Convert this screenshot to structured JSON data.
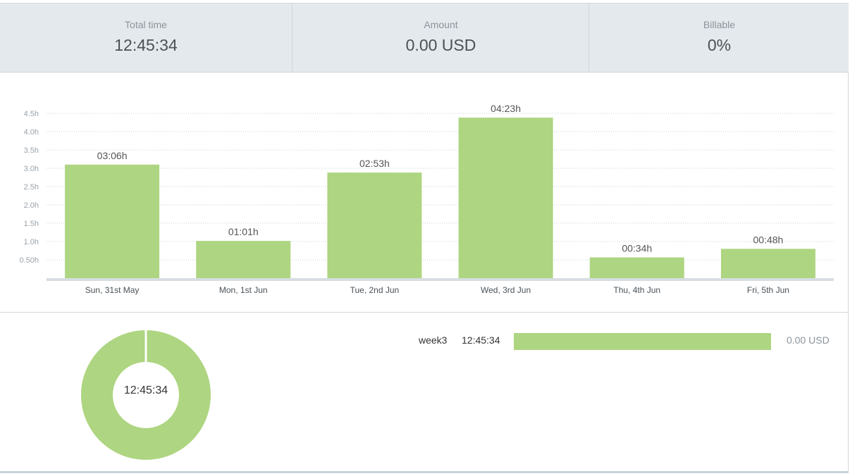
{
  "summary": {
    "total_time": {
      "label": "Total time",
      "value": "12:45:34"
    },
    "amount": {
      "label": "Amount",
      "value": "0.00 USD"
    },
    "billable": {
      "label": "Billable",
      "value": "0%"
    }
  },
  "colors": {
    "bar": "#aed581",
    "axis": "#d7dde2",
    "grid": "#c9cfd4",
    "tick_text": "#9aa3aa",
    "category_text": "#4a5157",
    "value_text": "#555555"
  },
  "chart_data": {
    "type": "bar",
    "categories": [
      "Sun, 31st May",
      "Mon, 1st Jun",
      "Tue, 2nd Jun",
      "Wed, 3rd Jun",
      "Thu, 4th Jun",
      "Fri, 5th Jun"
    ],
    "values": [
      3.1,
      1.0167,
      2.8833,
      4.3833,
      0.5667,
      0.8
    ],
    "value_labels": [
      "03:06h",
      "01:01h",
      "02:53h",
      "04:23h",
      "00:34h",
      "00:48h"
    ],
    "yticks": [
      "0.50h",
      "1.0h",
      "1.5h",
      "2.0h",
      "2.5h",
      "3.0h",
      "3.5h",
      "4.0h",
      "4.5h"
    ],
    "ytick_values": [
      0.5,
      1.0,
      1.5,
      2.0,
      2.5,
      3.0,
      3.5,
      4.0,
      4.5
    ],
    "ylim": [
      0,
      4.5
    ],
    "grid": true
  },
  "donut": {
    "center_label": "12:45:34",
    "share": 1.0
  },
  "projects": [
    {
      "name": "week3",
      "time": "12:45:34",
      "share": 1.0,
      "amount": "0.00 USD"
    }
  ]
}
